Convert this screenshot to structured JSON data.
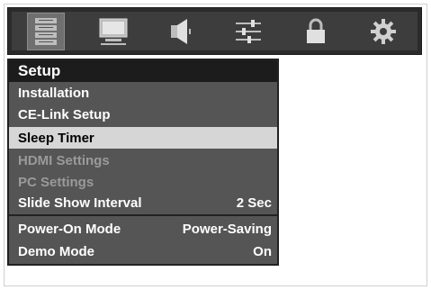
{
  "icon_bar": {
    "icons": [
      {
        "name": "setup-list-icon",
        "active": true
      },
      {
        "name": "picture-icon",
        "active": false
      },
      {
        "name": "sound-icon",
        "active": false
      },
      {
        "name": "adjust-sliders-icon",
        "active": false
      },
      {
        "name": "lock-icon",
        "active": false
      },
      {
        "name": "gear-icon",
        "active": false
      }
    ]
  },
  "menu": {
    "title": "Setup",
    "items": [
      {
        "label": "Installation",
        "value": "",
        "state": "normal"
      },
      {
        "label": "CE-Link Setup",
        "value": "",
        "state": "normal"
      },
      {
        "label": "Sleep Timer",
        "value": "",
        "state": "selected"
      },
      {
        "label": "HDMI Settings",
        "value": "",
        "state": "disabled"
      },
      {
        "label": "PC Settings",
        "value": "",
        "state": "disabled"
      },
      {
        "label": "Slide Show Interval",
        "value": "2 Sec",
        "state": "normal"
      },
      {
        "label": "Power-On Mode",
        "value": "Power-Saving",
        "state": "normal"
      },
      {
        "label": "Demo Mode",
        "value": "On",
        "state": "normal"
      }
    ]
  },
  "colors": {
    "menu_background": "#555555",
    "title_background": "#1c1c1c",
    "selected_background": "#d6d6d6",
    "disabled_text": "#9a9a9a"
  }
}
